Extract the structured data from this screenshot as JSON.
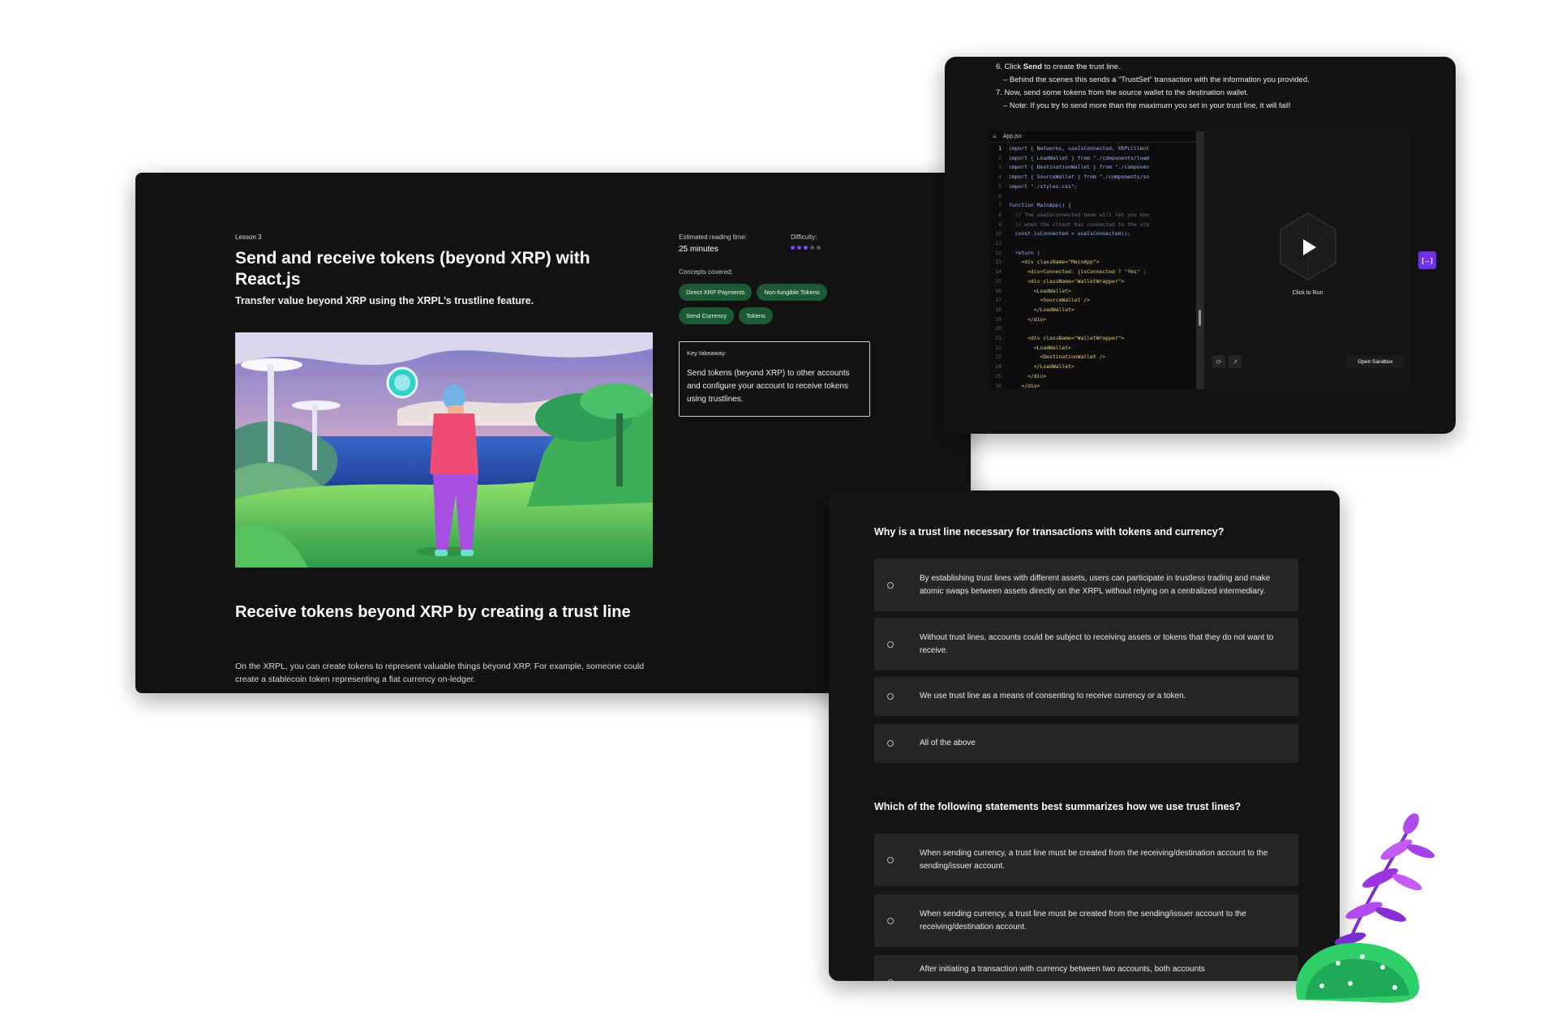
{
  "lesson": {
    "label": "Lesson 3",
    "title": "Send and receive tokens (beyond XRP) with React.js",
    "subtitle": "Transfer value beyond XRP using the XRPL’s trustline feature.",
    "reading_time_label": "Estimated reading time:",
    "reading_time_value": "25 minutes",
    "difficulty_label": "Difficulty:",
    "difficulty_level": 3,
    "difficulty_max": 5,
    "concepts_label": "Concepts covered:",
    "concepts": [
      "Direct XRP Payments",
      "Non-fungible Tokens",
      "Send Currency",
      "Tokens"
    ],
    "takeaway_label": "Key takeaway:",
    "takeaway_text": "Send tokens (beyond XRP) to other accounts and configure your account to receive tokens using trustlines.",
    "section_title": "Receive tokens beyond XRP by creating a trust line",
    "section_body": "On the XRPL, you can create tokens to represent valuable things beyond XRP. For example, someone could create a stablecoin token representing a fiat currency on-ledger."
  },
  "code_window": {
    "steps": [
      {
        "prefix": "6. Click ",
        "bold": "Send",
        "rest": " to create the trust line."
      },
      {
        "sub": "– Behind the scenes this sends a “TrustSet” transaction with the information you provided."
      },
      {
        "prefix": "7. Now, send some tokens from the source wallet to the destination wallet.",
        "bold": "",
        "rest": ""
      },
      {
        "sub": "– Note: If you try to send more than the maximum you set in your trust line, it will fail!"
      }
    ],
    "file_name": "App.jsx",
    "code": [
      "import { Networks, useIsConnected, XRPLClient",
      "import { LoadWallet } from \"./components/load",
      "import { DestinationWallet } from \"./componen",
      "import { SourceWallet } from \"./components/so",
      "import \"./styles.css\";",
      "",
      "function MainApp() {",
      "  // The useIsConnected hook will let you kno",
      "  // when the client has connected to the xrp",
      "  const isConnected = useIsConnected();",
      "",
      "  return (",
      "    <div className=\"MainApp\">",
      "      <div>Connected: {isConnected ? \"Yes\" :",
      "      <div className=\"WalletWrapper\">",
      "        <LoadWallet>",
      "          <SourceWallet />",
      "        </LoadWallet>",
      "      </div>",
      "",
      "      <div className=\"WalletWrapper\">",
      "        <LoadWallet>",
      "          <DestinationWallet />",
      "        </LoadWallet>",
      "      </div>",
      "    </div>"
    ],
    "run_label": "Click to Run",
    "open_sandbox_label": "Open Sandbox",
    "expand_icon": "[↔]"
  },
  "quiz": {
    "q1": "Why is a trust line necessary for transactions with tokens and currency?",
    "q1_options": [
      "By establishing trust lines with different assets, users can participate in trustless trading and make atomic swaps between assets directly on the XRPL without relying on a centralized intermediary.",
      "Without trust lines, accounts could be subject to receiving assets or tokens that they do not want to receive.",
      "We use trust line as a means of consenting to receive currency or a token.",
      "All of the above"
    ],
    "q2": "Which of the following statements best summarizes how we use trust lines?",
    "q2_options": [
      "When sending currency, a trust line must be created from the receiving/destination account to the sending/issuer account.",
      "When sending currency, a trust line must be created from the sending/issuer account to the receiving/destination account.",
      "After initiating a transaction with currency between two accounts, both accounts"
    ]
  },
  "colors": {
    "panel_bg": "#121212",
    "tag_bg": "#1c5a34",
    "accent_purple": "#6d33ef",
    "option_bg": "#262626"
  }
}
